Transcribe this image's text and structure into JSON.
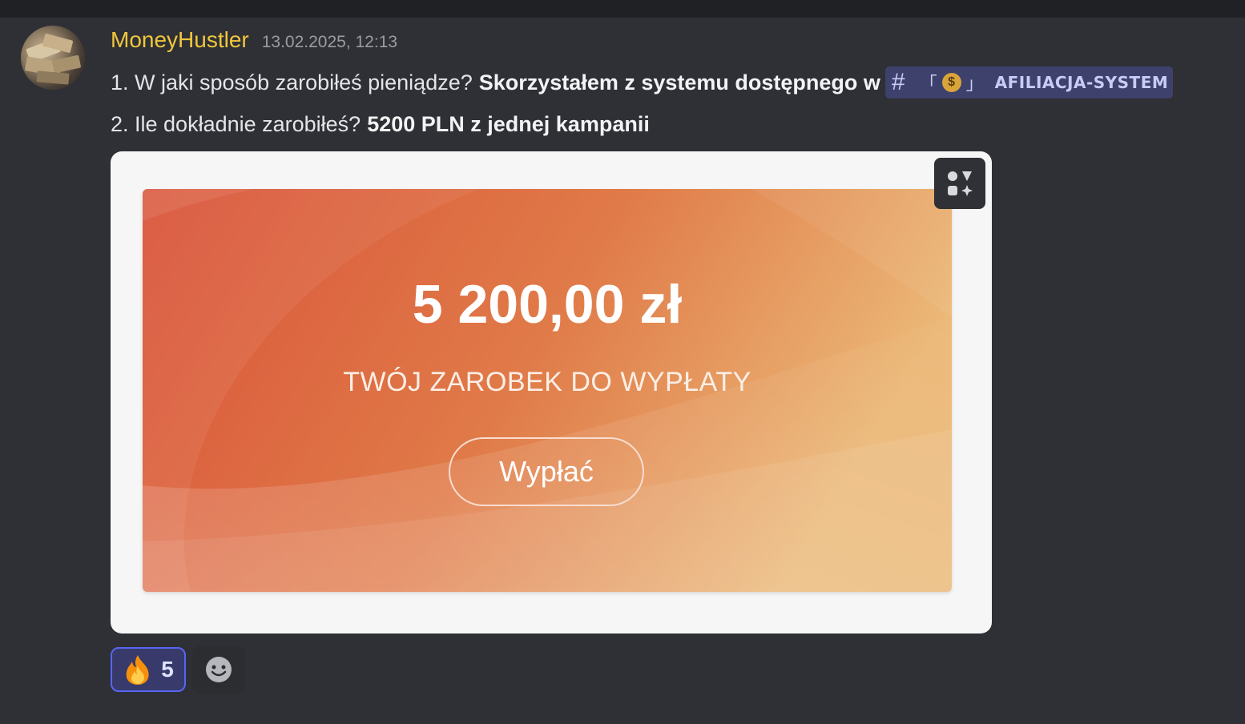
{
  "message": {
    "username": "MoneyHustler",
    "timestamp": "13.02.2025, 12:13",
    "line1_text": "1. W jaki sposób zarobiłeś pieniądze?",
    "line1_bold": "Skorzystałem z systemu dostępnego w",
    "channel_mention": {
      "hash": "#",
      "bracket_open": "「",
      "emoji": "$",
      "bracket_close": "」",
      "name": "AFILIACJA-SYSTEM"
    },
    "line2_text": "2. Ile dokładnie zarobiłeś?",
    "line2_bold": "5200 PLN z jednej kampanii"
  },
  "embed_image": {
    "amount": "5 200,00 zł",
    "subtitle": "TWÓJ ZAROBEK DO WYPŁATY",
    "button_label": "Wypłać"
  },
  "reactions": [
    {
      "icon": "fire-emoji",
      "count": "5"
    }
  ],
  "icons": {
    "apps": "apps-icon",
    "add_reaction": "add-reaction-smiley-icon"
  },
  "colors": {
    "username": "#f0c73c",
    "mention_bg": "#3d416b",
    "reaction_border": "#5865f2",
    "card_gradient_start": "#d9543a",
    "card_gradient_end": "#ebb877"
  }
}
